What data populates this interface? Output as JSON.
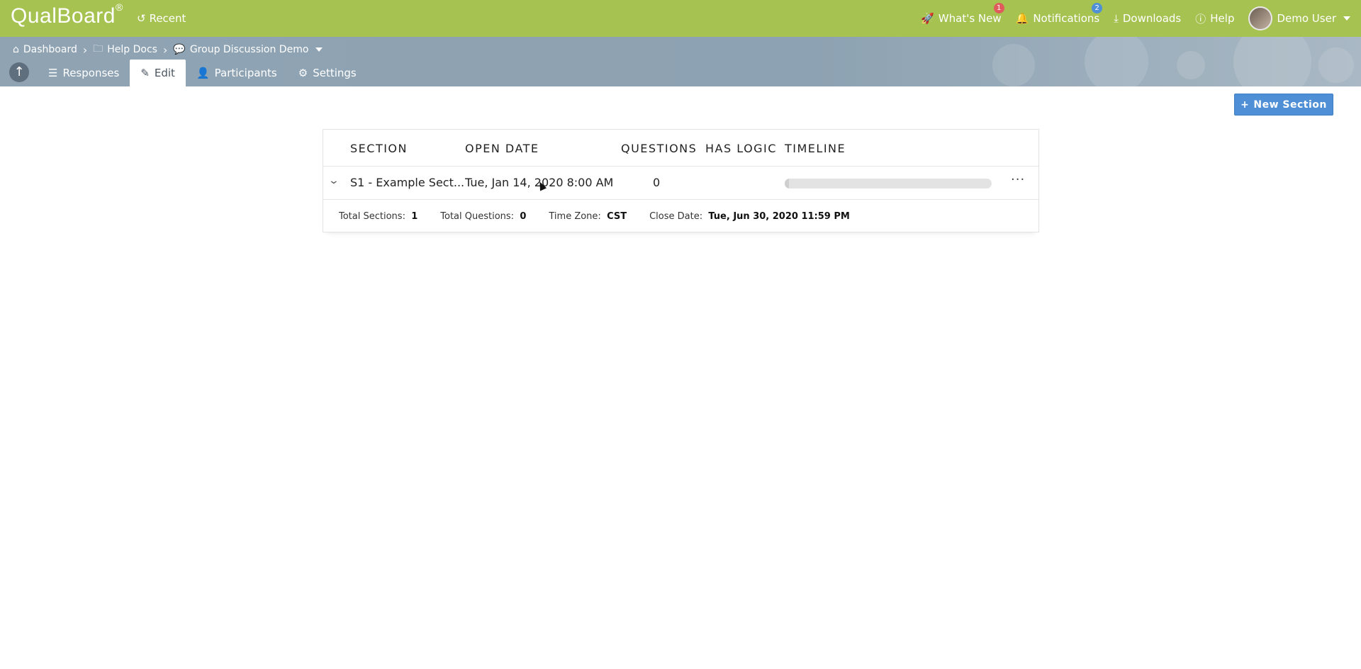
{
  "app": {
    "logo": "QualBoard",
    "logo_mark": "®",
    "recent_label": "Recent"
  },
  "topnav": {
    "whats_new": {
      "label": "What's New",
      "badge": "1"
    },
    "notifications": {
      "label": "Notifications",
      "badge": "2"
    },
    "downloads": {
      "label": "Downloads"
    },
    "help": {
      "label": "Help"
    },
    "user": {
      "name": "Demo User"
    }
  },
  "breadcrumb": {
    "items": [
      "Dashboard",
      "Help Docs",
      "Group Discussion Demo"
    ]
  },
  "tabs": [
    {
      "label": "Responses",
      "icon": "list-icon",
      "active": false
    },
    {
      "label": "Edit",
      "icon": "edit-icon",
      "active": true
    },
    {
      "label": "Participants",
      "icon": "user-icon",
      "active": false
    },
    {
      "label": "Settings",
      "icon": "gear-icon",
      "active": false
    }
  ],
  "actions": {
    "new_section": "New Section"
  },
  "table": {
    "headers": [
      "SECTION",
      "OPEN DATE",
      "QUESTIONS",
      "HAS LOGIC",
      "TIMELINE"
    ],
    "rows": [
      {
        "section": "S1 - Example Sect...",
        "open_date": "Tue, Jan 14, 2020 8:00 AM",
        "questions": "0",
        "has_logic": "",
        "timeline_progress": 0.02
      }
    ],
    "footer": {
      "total_sections_label": "Total Sections:",
      "total_sections": "1",
      "total_questions_label": "Total Questions:",
      "total_questions": "0",
      "time_zone_label": "Time Zone:",
      "time_zone": "CST",
      "close_date_label": "Close Date:",
      "close_date": "Tue, Jun 30, 2020 11:59 PM"
    }
  },
  "colors": {
    "topbar": "#a6c251",
    "subbar": "#8fa3b3",
    "primary_button": "#4e8fd6",
    "badge_red": "#e05c5c",
    "badge_blue": "#4e8fd6"
  }
}
